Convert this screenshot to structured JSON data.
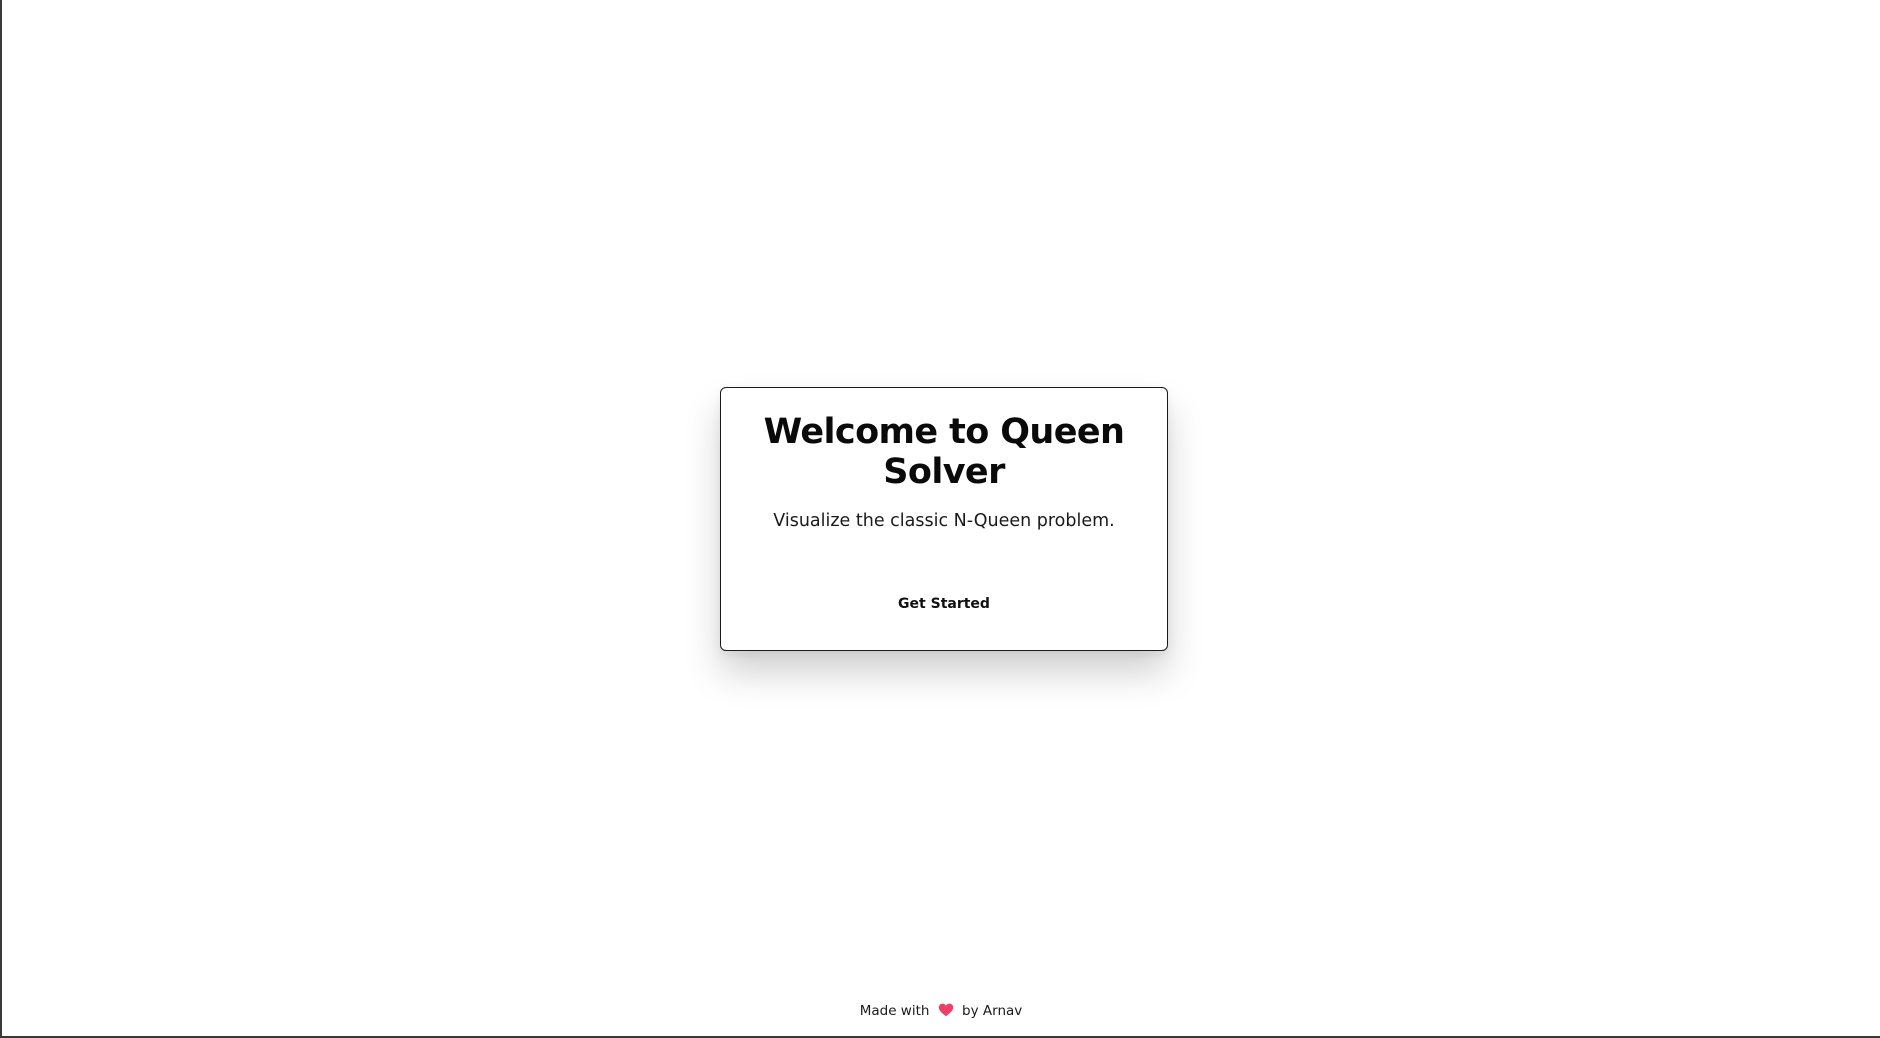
{
  "card": {
    "title": "Welcome to Queen Solver",
    "subtitle": "Visualize the classic N-Queen problem.",
    "button_label": "Get Started"
  },
  "footer": {
    "prefix": "Made with",
    "icon": "heart-icon",
    "icon_color": "#ee3f6b",
    "suffix": "by Arnav"
  }
}
